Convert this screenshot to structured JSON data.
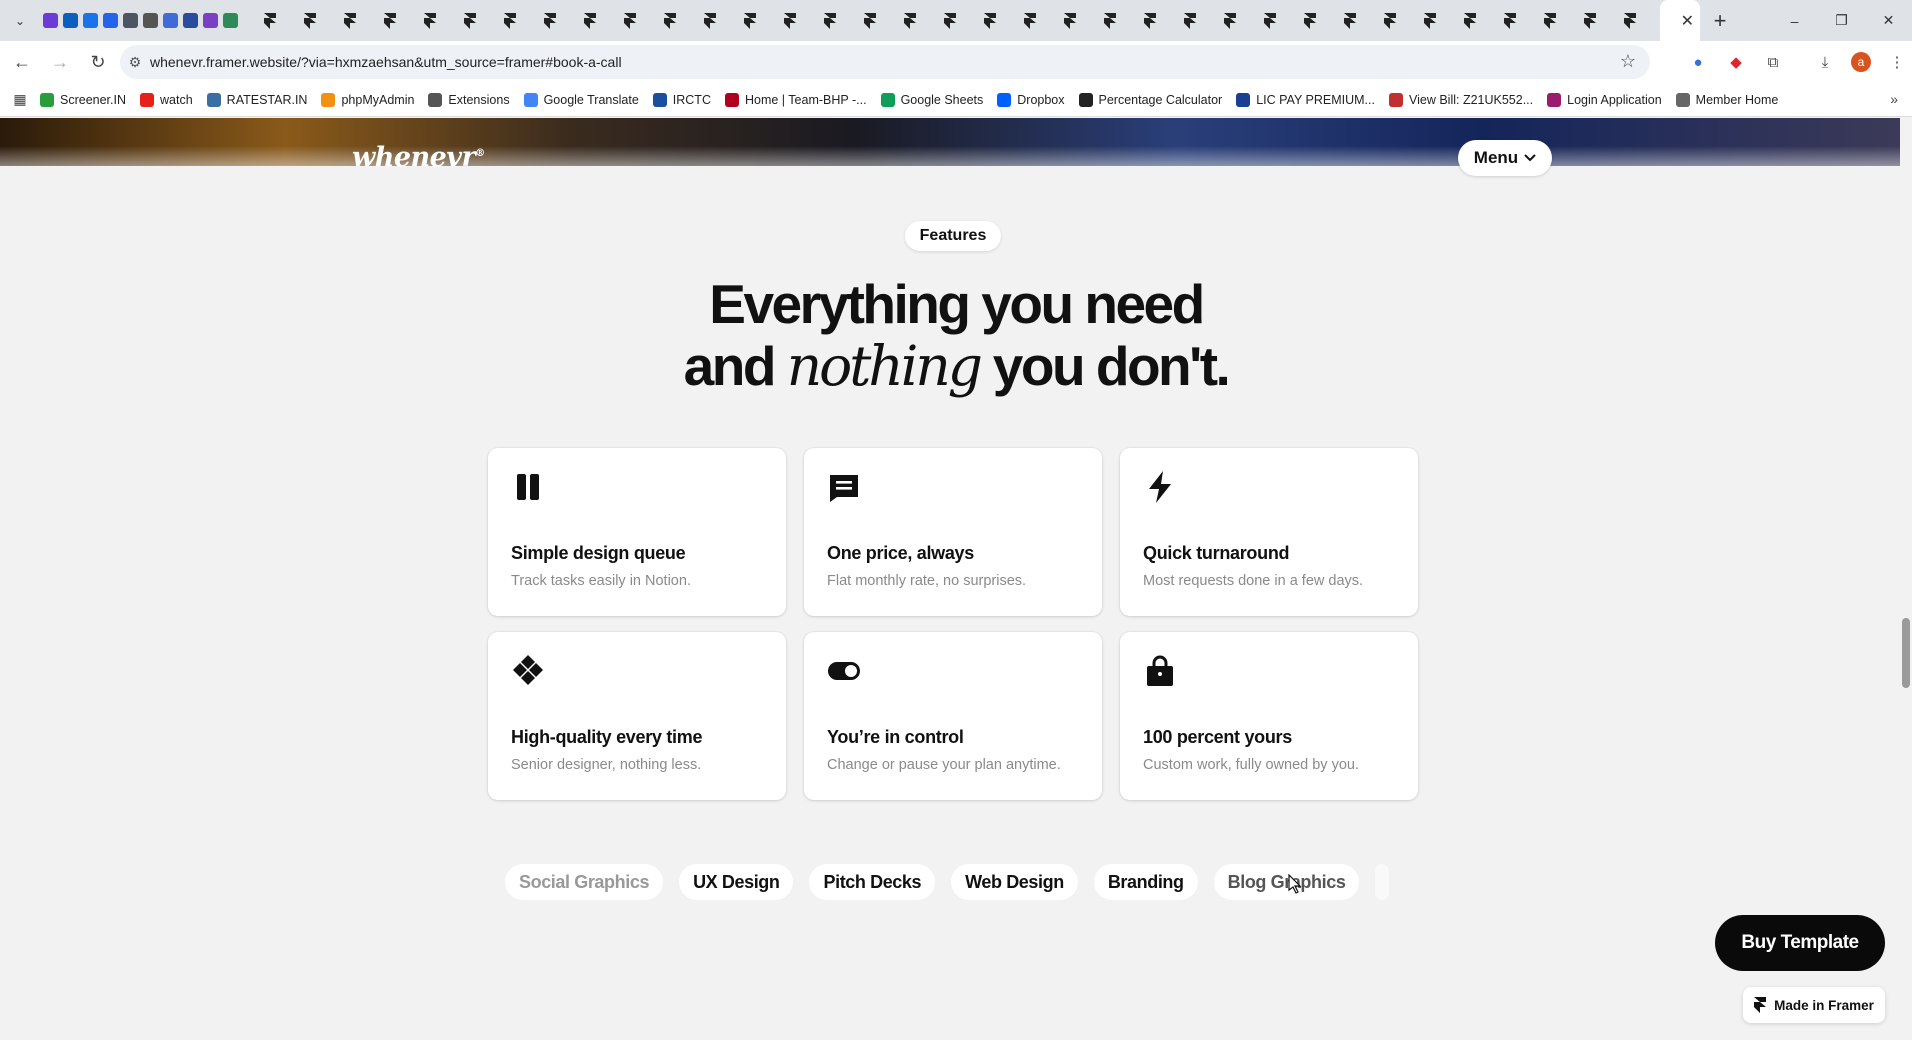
{
  "browser": {
    "url": "whenevr.framer.website/?via=hxmzaehsan&utm_source=framer#book-a-call",
    "window_controls": [
      "–",
      "❐",
      "✕"
    ],
    "new_tab": "+",
    "tab_close": "✕",
    "bookmarks": [
      {
        "label": "Screener.IN",
        "color": "#2a9d3b"
      },
      {
        "label": "watch",
        "color": "#e62117"
      },
      {
        "label": "RATESTAR.IN",
        "color": "#3a6ea5"
      },
      {
        "label": "phpMyAdmin",
        "color": "#f29111"
      },
      {
        "label": "Extensions",
        "color": "#555555"
      },
      {
        "label": "Google Translate",
        "color": "#4285f4"
      },
      {
        "label": "IRCTC",
        "color": "#1a4fa0"
      },
      {
        "label": "Home | Team-BHP -...",
        "color": "#b00020"
      },
      {
        "label": "Google Sheets",
        "color": "#0f9d58"
      },
      {
        "label": "Dropbox",
        "color": "#0061fe"
      },
      {
        "label": "Percentage Calculator",
        "color": "#222222"
      },
      {
        "label": "LIC PAY PREMIUM...",
        "color": "#1c3f94"
      },
      {
        "label": "View Bill: Z21UK552...",
        "color": "#c03030"
      },
      {
        "label": "Login Application",
        "color": "#9b1c6c"
      },
      {
        "label": "Member Home",
        "color": "#666666"
      }
    ]
  },
  "site": {
    "logo": "whenevr",
    "logo_mark": "®",
    "menu_label": "Menu",
    "section_badge": "Features",
    "headline_line1": "Everything you need",
    "headline_and": "and ",
    "headline_em": "nothing",
    "headline_rest": " you don't.",
    "features": [
      {
        "title": "Simple design queue",
        "subtitle": "Track tasks easily in Notion.",
        "icon": "pause-icon"
      },
      {
        "title": "One price, always",
        "subtitle": "Flat monthly rate, no surprises.",
        "icon": "receipt-icon"
      },
      {
        "title": "Quick turnaround",
        "subtitle": "Most requests done in a few days.",
        "icon": "lightning-icon"
      },
      {
        "title": "High-quality every time",
        "subtitle": "Senior designer, nothing less.",
        "icon": "diamond-grid-icon"
      },
      {
        "title": "You’re in control",
        "subtitle": "Change or pause your plan anytime.",
        "icon": "toggle-icon"
      },
      {
        "title": "100 percent yours",
        "subtitle": "Custom work, fully owned by you.",
        "icon": "bag-icon"
      }
    ],
    "services": [
      "Social Graphics",
      "UX Design",
      "Pitch Decks",
      "Web Design",
      "Branding",
      "Blog Graphics"
    ],
    "buy_label": "Buy Template",
    "made_in_framer": "Made in Framer"
  }
}
